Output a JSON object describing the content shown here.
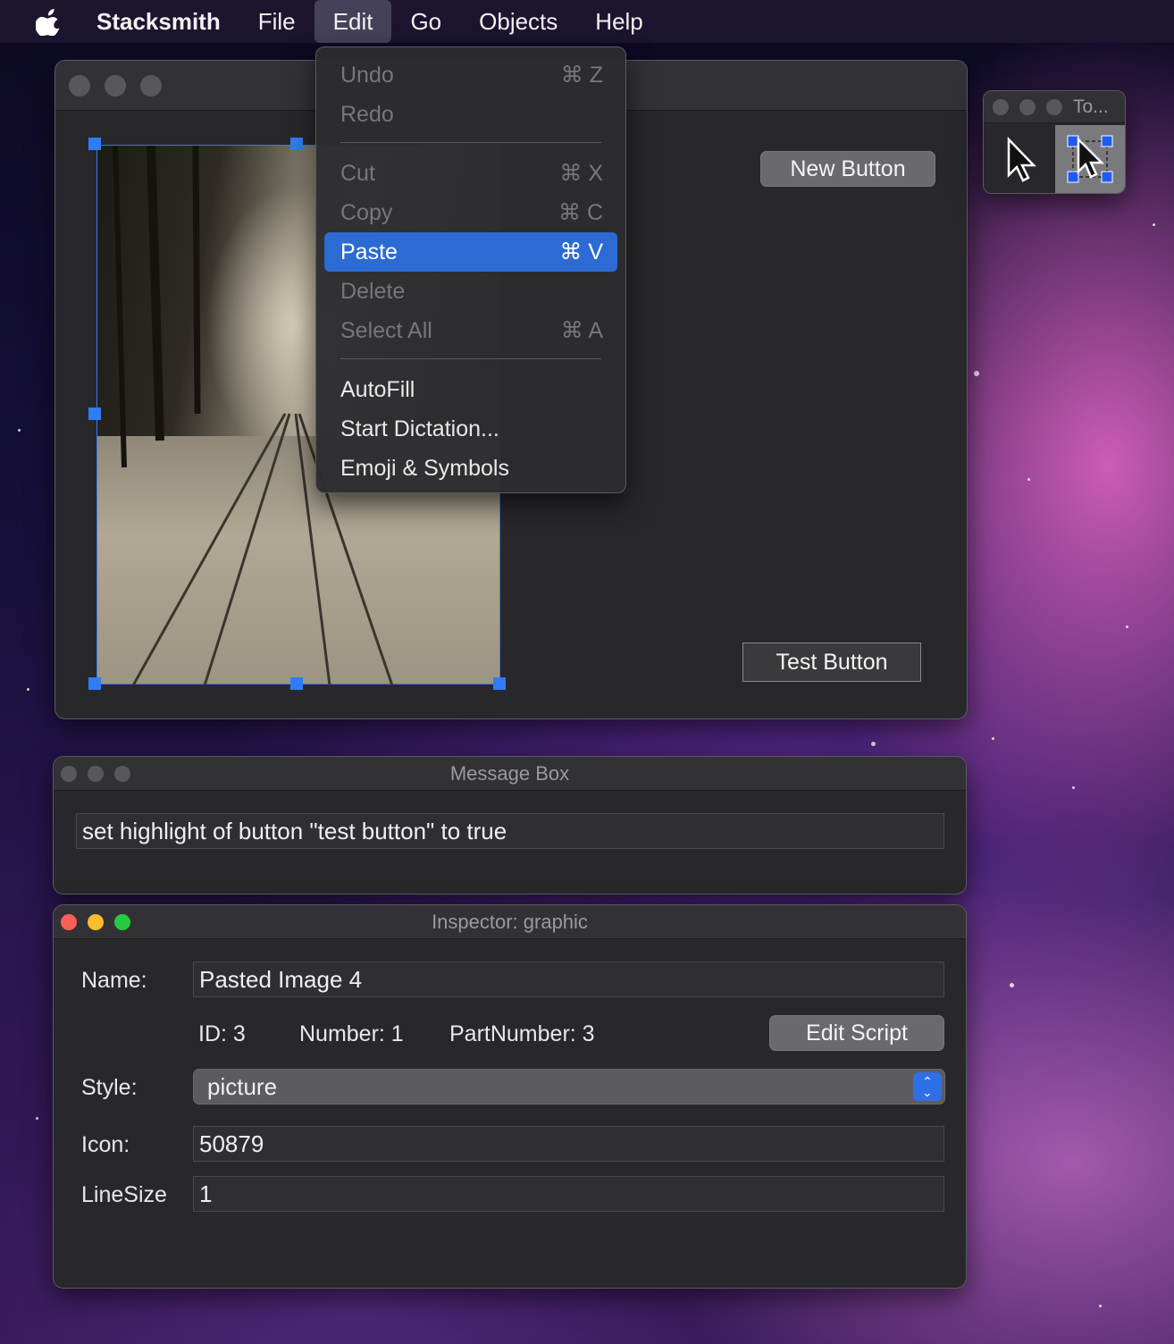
{
  "menubar": {
    "app_name": "Stacksmith",
    "items": [
      "File",
      "Edit",
      "Go",
      "Objects",
      "Help"
    ],
    "active": "Edit"
  },
  "edit_menu": {
    "items": [
      {
        "label": "Undo",
        "shortcut": "⌘ Z",
        "enabled": false
      },
      {
        "label": "Redo",
        "shortcut": "",
        "enabled": false
      },
      {
        "label": "Cut",
        "shortcut": "⌘ X",
        "enabled": false
      },
      {
        "label": "Copy",
        "shortcut": "⌘ C",
        "enabled": false
      },
      {
        "label": "Paste",
        "shortcut": "⌘ V",
        "enabled": true,
        "highlighted": true
      },
      {
        "label": "Delete",
        "shortcut": "",
        "enabled": false
      },
      {
        "label": "Select All",
        "shortcut": "⌘ A",
        "enabled": false
      },
      {
        "label": "AutoFill",
        "shortcut": "",
        "enabled": true
      },
      {
        "label": "Start Dictation...",
        "shortcut": "",
        "enabled": true
      },
      {
        "label": "Emoji & Symbols",
        "shortcut": "",
        "enabled": true
      }
    ]
  },
  "stack_window": {
    "new_button_label": "New Button",
    "test_button_label": "Test Button"
  },
  "tools_palette": {
    "title": "To..."
  },
  "message_box": {
    "title": "Message Box",
    "text": "set highlight of button \"test button\" to true"
  },
  "inspector": {
    "title": "Inspector:  graphic",
    "name_label": "Name:",
    "name_value": "Pasted Image 4",
    "id_text": "ID: 3",
    "number_text": "Number: 1",
    "partnumber_text": "PartNumber: 3",
    "edit_script_label": "Edit Script",
    "style_label": "Style:",
    "style_value": "picture",
    "icon_label": "Icon:",
    "icon_value": "50879",
    "linesize_label": "LineSize",
    "linesize_value": "1"
  },
  "colors": {
    "accent": "#2c6bd4",
    "selection_handle": "#2f7df6",
    "close": "#fe5f57",
    "minimize": "#febc2e",
    "zoom": "#28c840"
  }
}
